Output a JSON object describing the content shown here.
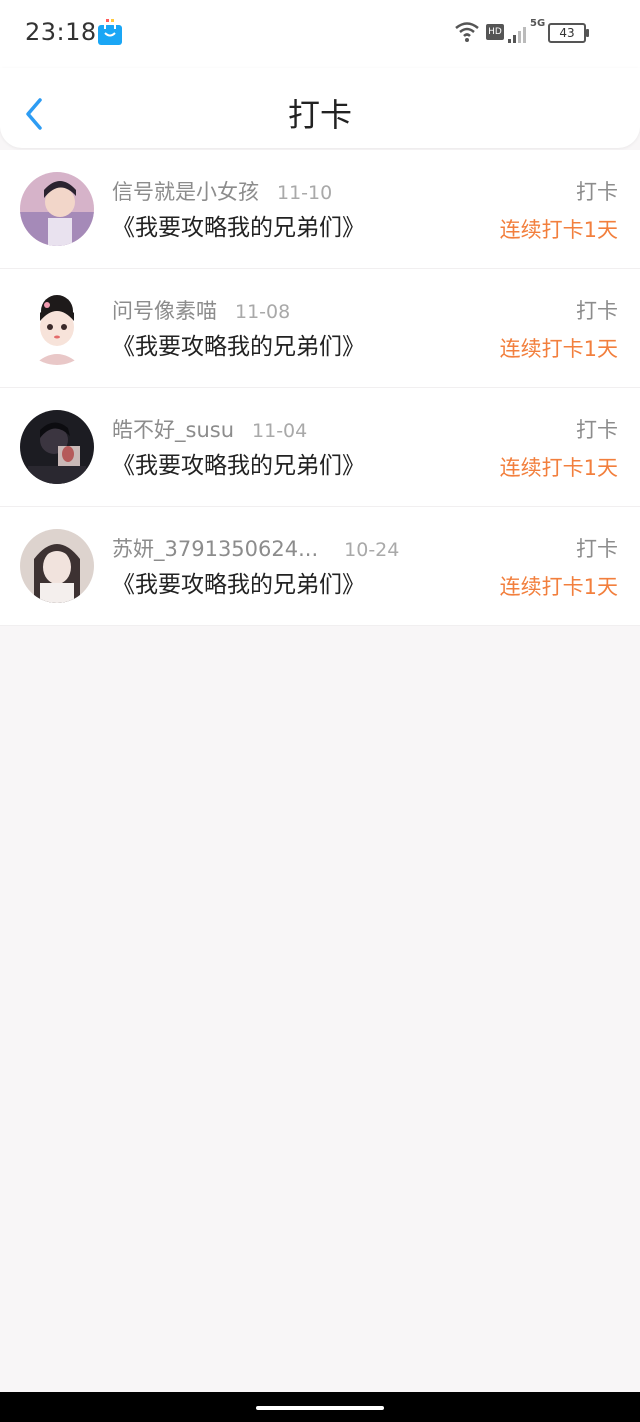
{
  "status_bar": {
    "time": "23:18",
    "network": "5G",
    "hd": "HD",
    "battery": "43",
    "icons": [
      "app-bag-icon",
      "wifi-icon",
      "hd-icon",
      "signal-icon",
      "battery-icon"
    ]
  },
  "header": {
    "title": "打卡",
    "back_icon": "chevron-left-icon"
  },
  "checkins": [
    {
      "name": "信号就是小女孩",
      "date": "11-10",
      "book": "《我要攻略我的兄弟们》",
      "action": "打卡",
      "streak": "连续打卡1天"
    },
    {
      "name": "问号像素喵",
      "date": "11-08",
      "book": "《我要攻略我的兄弟们》",
      "action": "打卡",
      "streak": "连续打卡1天"
    },
    {
      "name": "皓不好_susu",
      "date": "11-04",
      "book": "《我要攻略我的兄弟们》",
      "action": "打卡",
      "streak": "连续打卡1天"
    },
    {
      "name": "苏妍_3791350624...",
      "date": "10-24",
      "book": "《我要攻略我的兄弟们》",
      "action": "打卡",
      "streak": "连续打卡1天"
    }
  ],
  "colors": {
    "accent_blue": "#2d9cf3",
    "streak_orange": "#f27f3d",
    "background": "#f8f6f7"
  }
}
